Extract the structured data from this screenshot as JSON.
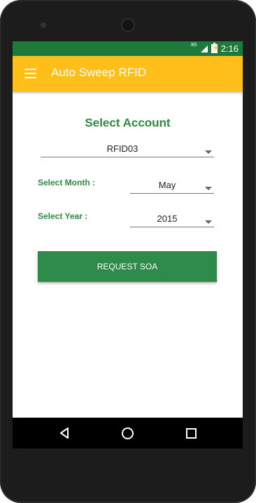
{
  "status_bar": {
    "network": "3G",
    "time": "2:16",
    "color": "#1e7a3a"
  },
  "app_bar": {
    "title": "Auto Sweep RFID",
    "color": "#ffbe19",
    "menu_icon": "hamburger-menu-icon"
  },
  "form": {
    "heading": "Select Account",
    "account": {
      "value": "RFID03"
    },
    "month": {
      "label": "Select Month :",
      "value": "May"
    },
    "year": {
      "label": "Select Year :",
      "value": "2015"
    },
    "submit_label": "REQUEST SOA",
    "accent_color": "#2e8b3e"
  },
  "nav_bar": {
    "icons": [
      "back-icon",
      "home-icon",
      "recent-apps-icon"
    ]
  }
}
